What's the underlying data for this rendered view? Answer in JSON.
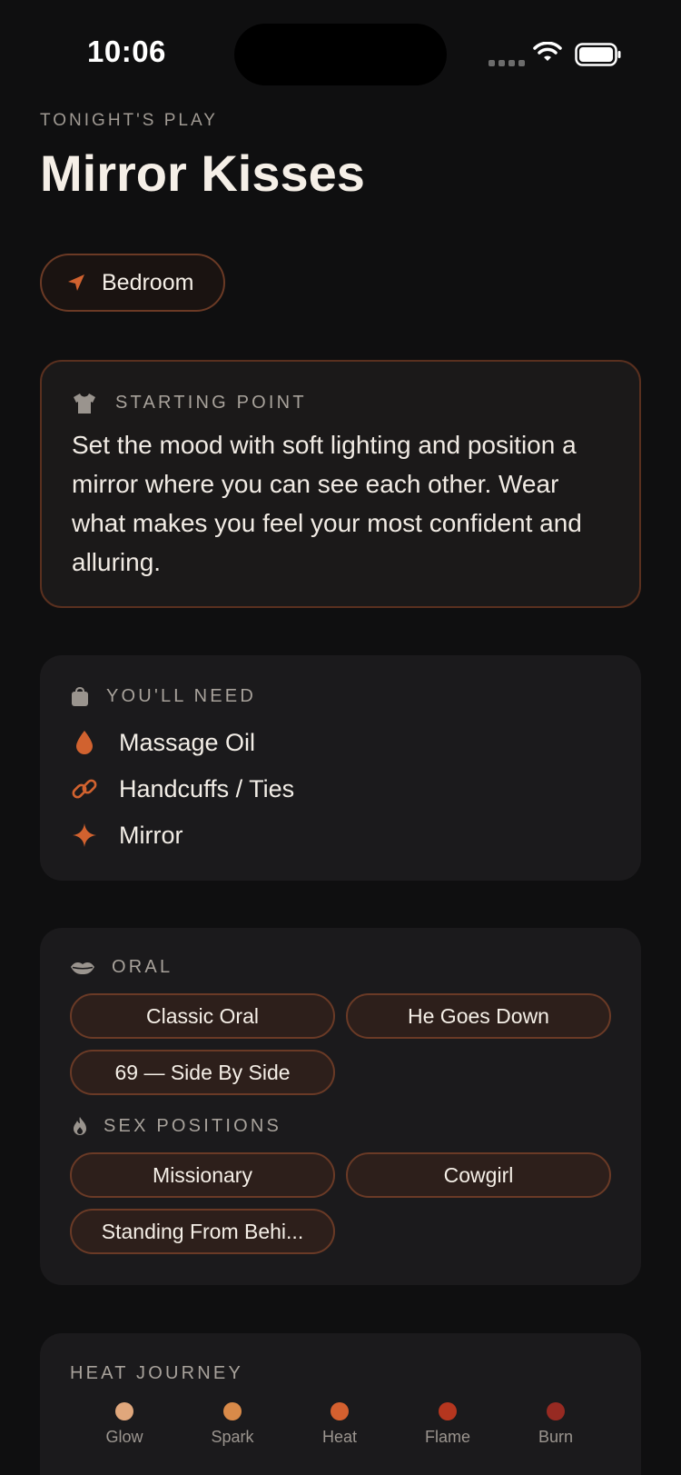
{
  "status": {
    "time": "10:06"
  },
  "header": {
    "eyebrow": "TONIGHT'S PLAY",
    "title": "Mirror Kisses"
  },
  "location": {
    "label": "Bedroom",
    "icon": "location-arrow-icon"
  },
  "starting_point": {
    "label": "STARTING POINT",
    "icon": "tshirt-icon",
    "text": "Set the mood with soft lighting and position a mirror where you can see each other. Wear what makes you feel your most confident and alluring."
  },
  "needs": {
    "label": "YOU'LL NEED",
    "icon": "bag-icon",
    "items": [
      {
        "label": "Massage Oil",
        "icon": "drop-icon"
      },
      {
        "label": "Handcuffs / Ties",
        "icon": "link-icon"
      },
      {
        "label": "Mirror",
        "icon": "sparkle-icon"
      }
    ]
  },
  "oral": {
    "label": "ORAL",
    "icon": "lips-icon",
    "chips": [
      "Classic Oral",
      "He Goes Down",
      "69 — Side By Side"
    ]
  },
  "positions": {
    "label": "SEX POSITIONS",
    "icon": "flame-icon",
    "chips": [
      "Missionary",
      "Cowgirl",
      "Standing From Behi..."
    ]
  },
  "heat_journey": {
    "label": "HEAT JOURNEY",
    "steps": [
      {
        "label": "Glow",
        "color": "#e0a77c"
      },
      {
        "label": "Spark",
        "color": "#d98a49"
      },
      {
        "label": "Heat",
        "color": "#d4602f"
      },
      {
        "label": "Flame",
        "color": "#b5361f"
      },
      {
        "label": "Burn",
        "color": "#972a22"
      }
    ]
  },
  "colors": {
    "accent": "#d1622f",
    "background": "#0f0f10",
    "card": "#1b1a1c"
  }
}
